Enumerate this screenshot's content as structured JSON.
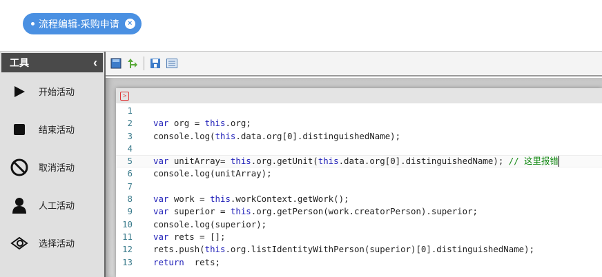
{
  "tab": {
    "label": "流程编辑-采购申请",
    "close_icon": "close-circle-icon"
  },
  "sidebar": {
    "title": "工具",
    "collapse_icon": "chevron-left-icon",
    "items": [
      {
        "label": "开始活动",
        "icon": "play-icon"
      },
      {
        "label": "结束活动",
        "icon": "stop-icon"
      },
      {
        "label": "取消活动",
        "icon": "ban-icon"
      },
      {
        "label": "人工活动",
        "icon": "person-icon"
      },
      {
        "label": "选择活动",
        "icon": "choice-icon"
      }
    ]
  },
  "toolbar": {
    "icons": [
      "save-icon",
      "publish-icon",
      "save-as-icon",
      "properties-icon"
    ]
  },
  "editor": {
    "lines": [
      [],
      [
        [
          "kw",
          "var"
        ],
        [
          "tx",
          " org = "
        ],
        [
          "kw",
          "this"
        ],
        [
          "tx",
          ".org;"
        ]
      ],
      [
        [
          "tx",
          "console.log("
        ],
        [
          "kw",
          "this"
        ],
        [
          "tx",
          ".data.org[0].distinguishedName);"
        ]
      ],
      [],
      [
        [
          "kw",
          "var"
        ],
        [
          "tx",
          " unitArray= "
        ],
        [
          "kw",
          "this"
        ],
        [
          "tx",
          ".org.getUnit("
        ],
        [
          "kw",
          "this"
        ],
        [
          "tx",
          ".data.org[0].distinguishedName); "
        ],
        [
          "cm",
          "// 这里报错"
        ]
      ],
      [
        [
          "tx",
          "console.log(unitArray);"
        ]
      ],
      [],
      [
        [
          "kw",
          "var"
        ],
        [
          "tx",
          " work = "
        ],
        [
          "kw",
          "this"
        ],
        [
          "tx",
          ".workContext.getWork();"
        ]
      ],
      [
        [
          "kw",
          "var"
        ],
        [
          "tx",
          " superior = "
        ],
        [
          "kw",
          "this"
        ],
        [
          "tx",
          ".org.getPerson(work.creatorPerson).superior;"
        ]
      ],
      [
        [
          "tx",
          "console.log(superior);"
        ]
      ],
      [
        [
          "kw",
          "var"
        ],
        [
          "tx",
          " rets = [];"
        ]
      ],
      [
        [
          "tx",
          "rets.push("
        ],
        [
          "kw",
          "this"
        ],
        [
          "tx",
          ".org.listIdentityWithPerson(superior)[0].distinguishedName);"
        ]
      ],
      [
        [
          "kw",
          "return"
        ],
        [
          "tx",
          "  rets;"
        ]
      ]
    ],
    "active_line": 5
  }
}
